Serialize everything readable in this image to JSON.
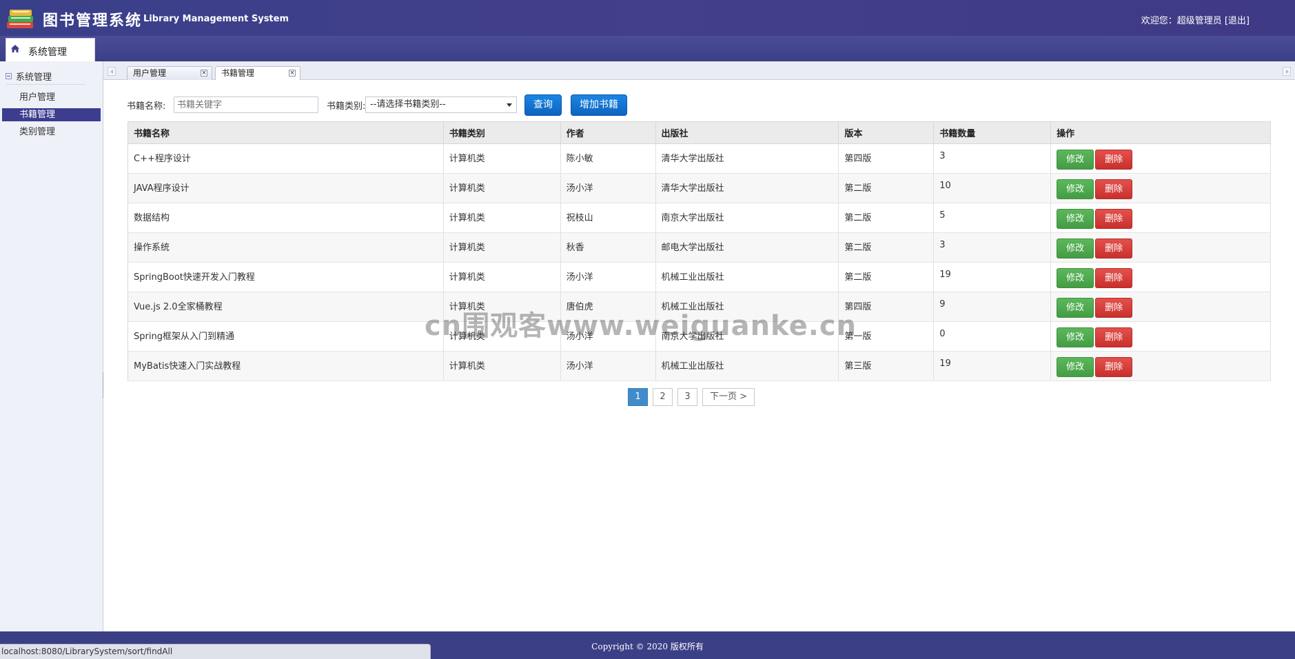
{
  "header": {
    "title": "图书管理系统",
    "subtitle": "Library Management System",
    "welcome": "欢迎您：超级管理员",
    "logout": "[退出]",
    "logo_icon": "books-stack-icon"
  },
  "nav": {
    "tab_label": "系统管理",
    "tab_icon": "home-icon"
  },
  "sidebar": {
    "root_label": "系统管理",
    "items": [
      {
        "label": "用户管理",
        "active": false
      },
      {
        "label": "书籍管理",
        "active": true
      },
      {
        "label": "类别管理",
        "active": false
      }
    ]
  },
  "tabs": [
    {
      "label": "用户管理",
      "active": false
    },
    {
      "label": "书籍管理",
      "active": true
    }
  ],
  "search": {
    "name_label": "书籍名称:",
    "name_placeholder": "书籍关键字",
    "category_label": "书籍类别:",
    "category_selected": "--请选择书籍类别--",
    "query_button": "查询",
    "add_button": "增加书籍"
  },
  "table": {
    "columns": [
      "书籍名称",
      "书籍类别",
      "作者",
      "出版社",
      "版本",
      "书籍数量",
      "操作"
    ],
    "rows": [
      {
        "name": "C++程序设计",
        "category": "计算机类",
        "author": "陈小敏",
        "publisher": "清华大学出版社",
        "edition": "第四版",
        "count": "3"
      },
      {
        "name": "JAVA程序设计",
        "category": "计算机类",
        "author": "汤小洋",
        "publisher": "清华大学出版社",
        "edition": "第二版",
        "count": "10"
      },
      {
        "name": "数据结构",
        "category": "计算机类",
        "author": "祝枝山",
        "publisher": "南京大学出版社",
        "edition": "第二版",
        "count": "5"
      },
      {
        "name": "操作系统",
        "category": "计算机类",
        "author": "秋香",
        "publisher": "邮电大学出版社",
        "edition": "第二版",
        "count": "3"
      },
      {
        "name": "SpringBoot快速开发入门教程",
        "category": "计算机类",
        "author": "汤小洋",
        "publisher": "机械工业出版社",
        "edition": "第二版",
        "count": "19"
      },
      {
        "name": "Vue.js 2.0全家桶教程",
        "category": "计算机类",
        "author": "唐伯虎",
        "publisher": "机械工业出版社",
        "edition": "第四版",
        "count": "9"
      },
      {
        "name": "Spring框架从入门到精通",
        "category": "计算机类",
        "author": "汤小洋",
        "publisher": "南京大学出版社",
        "edition": "第一版",
        "count": "0"
      },
      {
        "name": "MyBatis快速入门实战教程",
        "category": "计算机类",
        "author": "汤小洋",
        "publisher": "机械工业出版社",
        "edition": "第三版",
        "count": "19"
      }
    ],
    "edit_label": "修改",
    "delete_label": "删除"
  },
  "pagination": {
    "pages": [
      "1",
      "2",
      "3"
    ],
    "current": "1",
    "next": "下一页 >"
  },
  "watermark": "cn围观客www.weiguanke.cn",
  "footer": {
    "copyright": "Copyright © 2020 版权所有"
  },
  "statusbar": {
    "url": "localhost:8080/LibrarySystem/sort/findAll"
  },
  "colors": {
    "header_bg": "#3a3f8a",
    "active_item": "#3c3d8f",
    "query_button": "#1b85e3",
    "edit_button": "#5cb85c",
    "delete_button": "#d9534f",
    "pager_active": "#428bca"
  }
}
